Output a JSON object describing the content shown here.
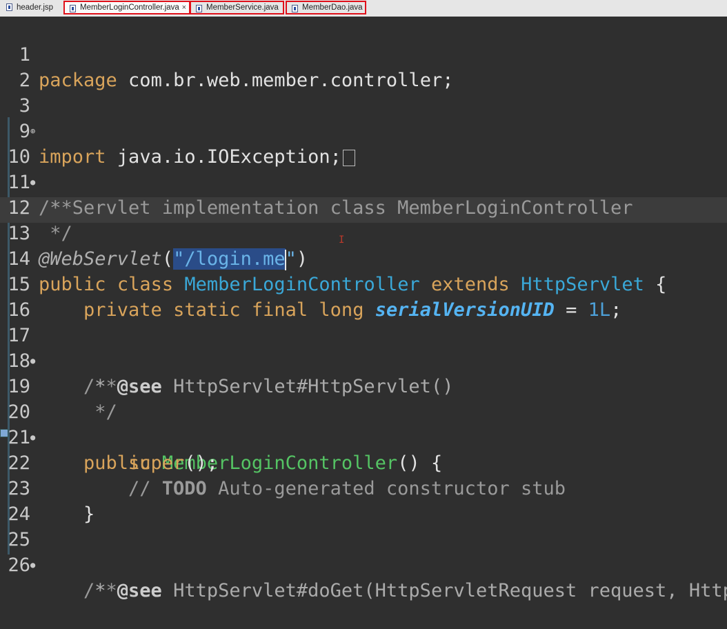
{
  "tabs": [
    {
      "label": "header.jsp"
    },
    {
      "label": "MemberLoginController.java",
      "close": "×"
    },
    {
      "label": "MemberService.java"
    },
    {
      "label": "MemberDao.java"
    }
  ],
  "lines": {
    "l1": {
      "num": "1",
      "package_kw": "package",
      "rest": " com.br.web.member.controller;"
    },
    "l2": {
      "num": "2"
    },
    "l3": {
      "num": "3",
      "import_kw": "import",
      "rest": " java.io.IOException;"
    },
    "l9": {
      "num": "9"
    },
    "l10": {
      "num": "10",
      "text": "/**"
    },
    "l11": {
      "num": "11",
      "text": " * Servlet implementation class MemberLoginController"
    },
    "l12": {
      "num": "12",
      "text": " */"
    },
    "l13": {
      "num": "13",
      "ann": "@WebServlet",
      "open": "(",
      "str_q": "\"",
      "str_sel": "/login.me",
      "str_end": "\"",
      "close": ")"
    },
    "l14": {
      "num": "14",
      "kw1": "public",
      "kw2": "class",
      "cls": "MemberLoginController",
      "kw3": "extends",
      "base": "HttpServlet",
      "brace": " {"
    },
    "l15": {
      "num": "15",
      "kw1": "private",
      "kw2": "static",
      "kw3": "final",
      "kw4": "long",
      "field": "serialVersionUID",
      "eq": " = ",
      "val": "1L",
      "semi": ";"
    },
    "l16": {
      "num": "16"
    },
    "l17": {
      "num": "17",
      "text": "/**"
    },
    "l18": {
      "num": "18",
      "star": " * ",
      "tag": "@see",
      "ref": " HttpServlet#HttpServlet()"
    },
    "l19": {
      "num": "19",
      "text": " */"
    },
    "l20": {
      "num": "20",
      "kw": "public",
      "ctor": "MemberLoginController",
      "rest": "() {"
    },
    "l21": {
      "num": "21",
      "kw": "super",
      "rest": "();"
    },
    "l22": {
      "num": "22",
      "slashes": "// ",
      "todo": "TODO",
      "rest": " Auto-generated constructor stub"
    },
    "l23": {
      "num": "23",
      "text": "}"
    },
    "l24": {
      "num": "24"
    },
    "l25": {
      "num": "25",
      "text": "/**"
    },
    "l26": {
      "num": "26",
      "star": " * ",
      "tag": "@see",
      "ref": " HttpServlet#doGet(HttpServletRequest request, Http"
    }
  },
  "colors": {
    "background": "#2f2f2f",
    "keyword": "#d9a45b",
    "string": "#6ab4e8",
    "selection": "#2a4c88",
    "class_ref": "#3aa8d8",
    "method": "#55c464",
    "tab_highlight_border": "#e0101a"
  }
}
